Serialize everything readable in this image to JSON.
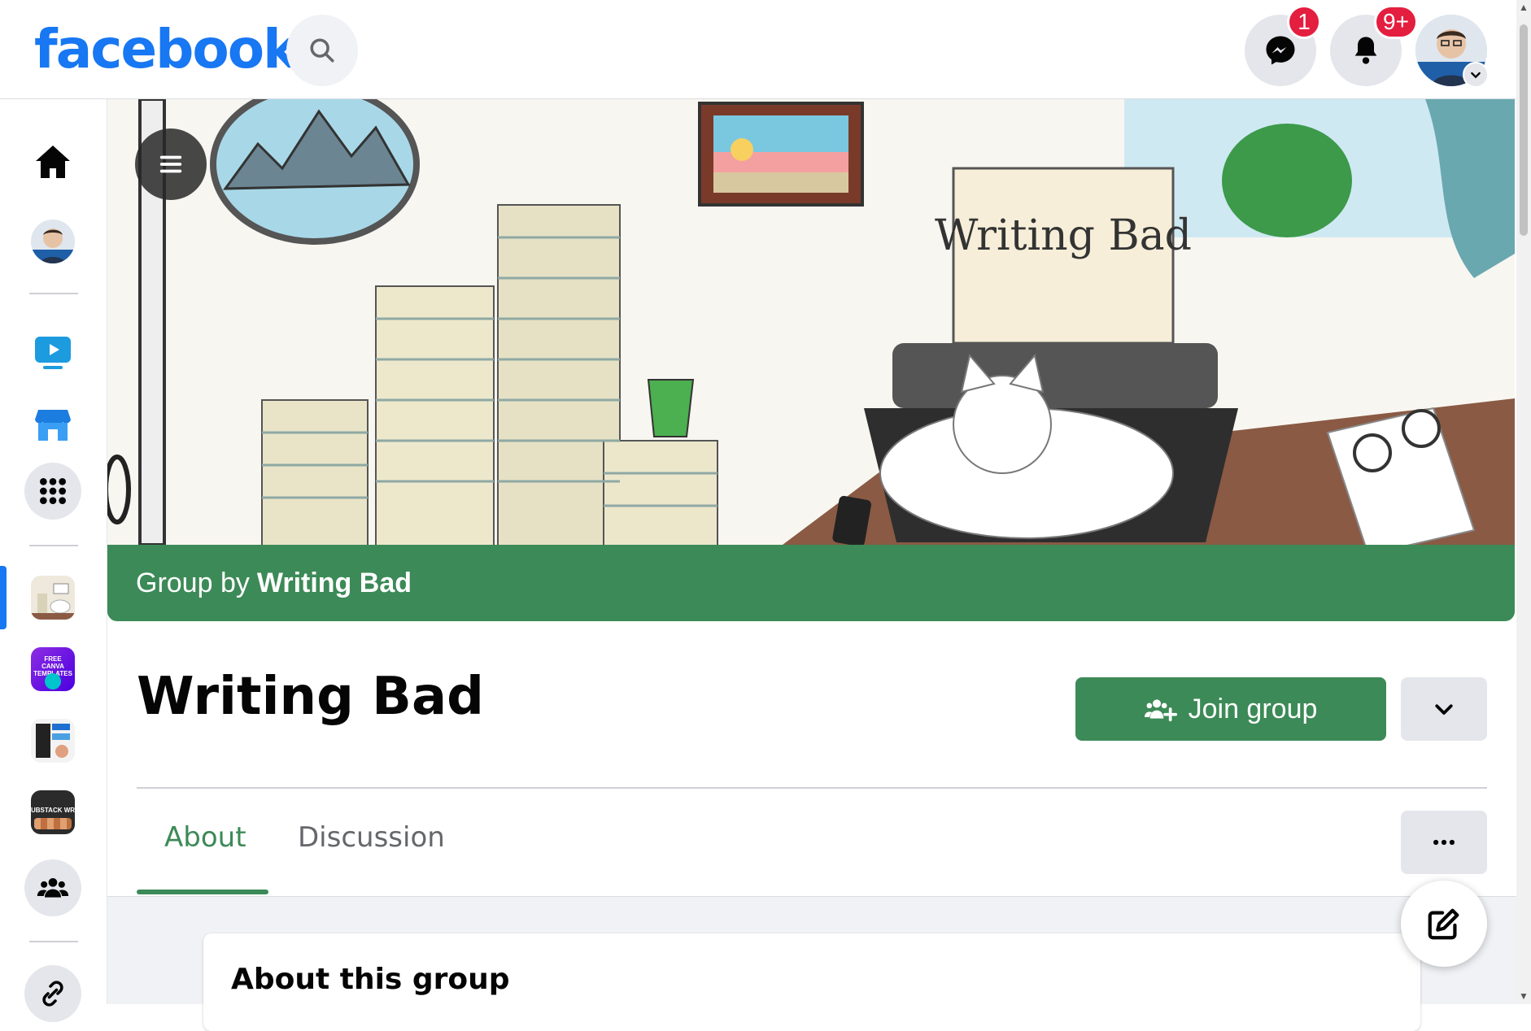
{
  "header": {
    "logo": "facebook",
    "messenger_badge": "1",
    "notifications_badge": "9+"
  },
  "colors": {
    "brand_blue": "#1877f2",
    "group_green": "#3c8a57",
    "badge_red": "#e41e3f"
  },
  "sidebar": {
    "items": [
      {
        "icon": "home-icon"
      },
      {
        "icon": "profile-avatar"
      },
      {
        "icon": "watch-icon"
      },
      {
        "icon": "marketplace-icon"
      },
      {
        "icon": "menu-grid-icon"
      },
      {
        "icon": "group-thumbnail-writing-bad"
      },
      {
        "icon": "group-thumbnail-canva",
        "text": "FREE CANVA TEMPLATES"
      },
      {
        "icon": "group-thumbnail-3"
      },
      {
        "icon": "group-thumbnail-substack",
        "text": "UBSTACK WRITE"
      },
      {
        "icon": "groups-icon"
      },
      {
        "icon": "link-icon"
      }
    ]
  },
  "cover": {
    "sign_text": "Writing Bad"
  },
  "group": {
    "by_prefix": "Group by",
    "by_name": "Writing Bad",
    "title": "Writing Bad",
    "join_label": "Join group"
  },
  "tabs": [
    {
      "label": "About",
      "active": true
    },
    {
      "label": "Discussion",
      "active": false
    }
  ],
  "about": {
    "title": "About this group"
  }
}
